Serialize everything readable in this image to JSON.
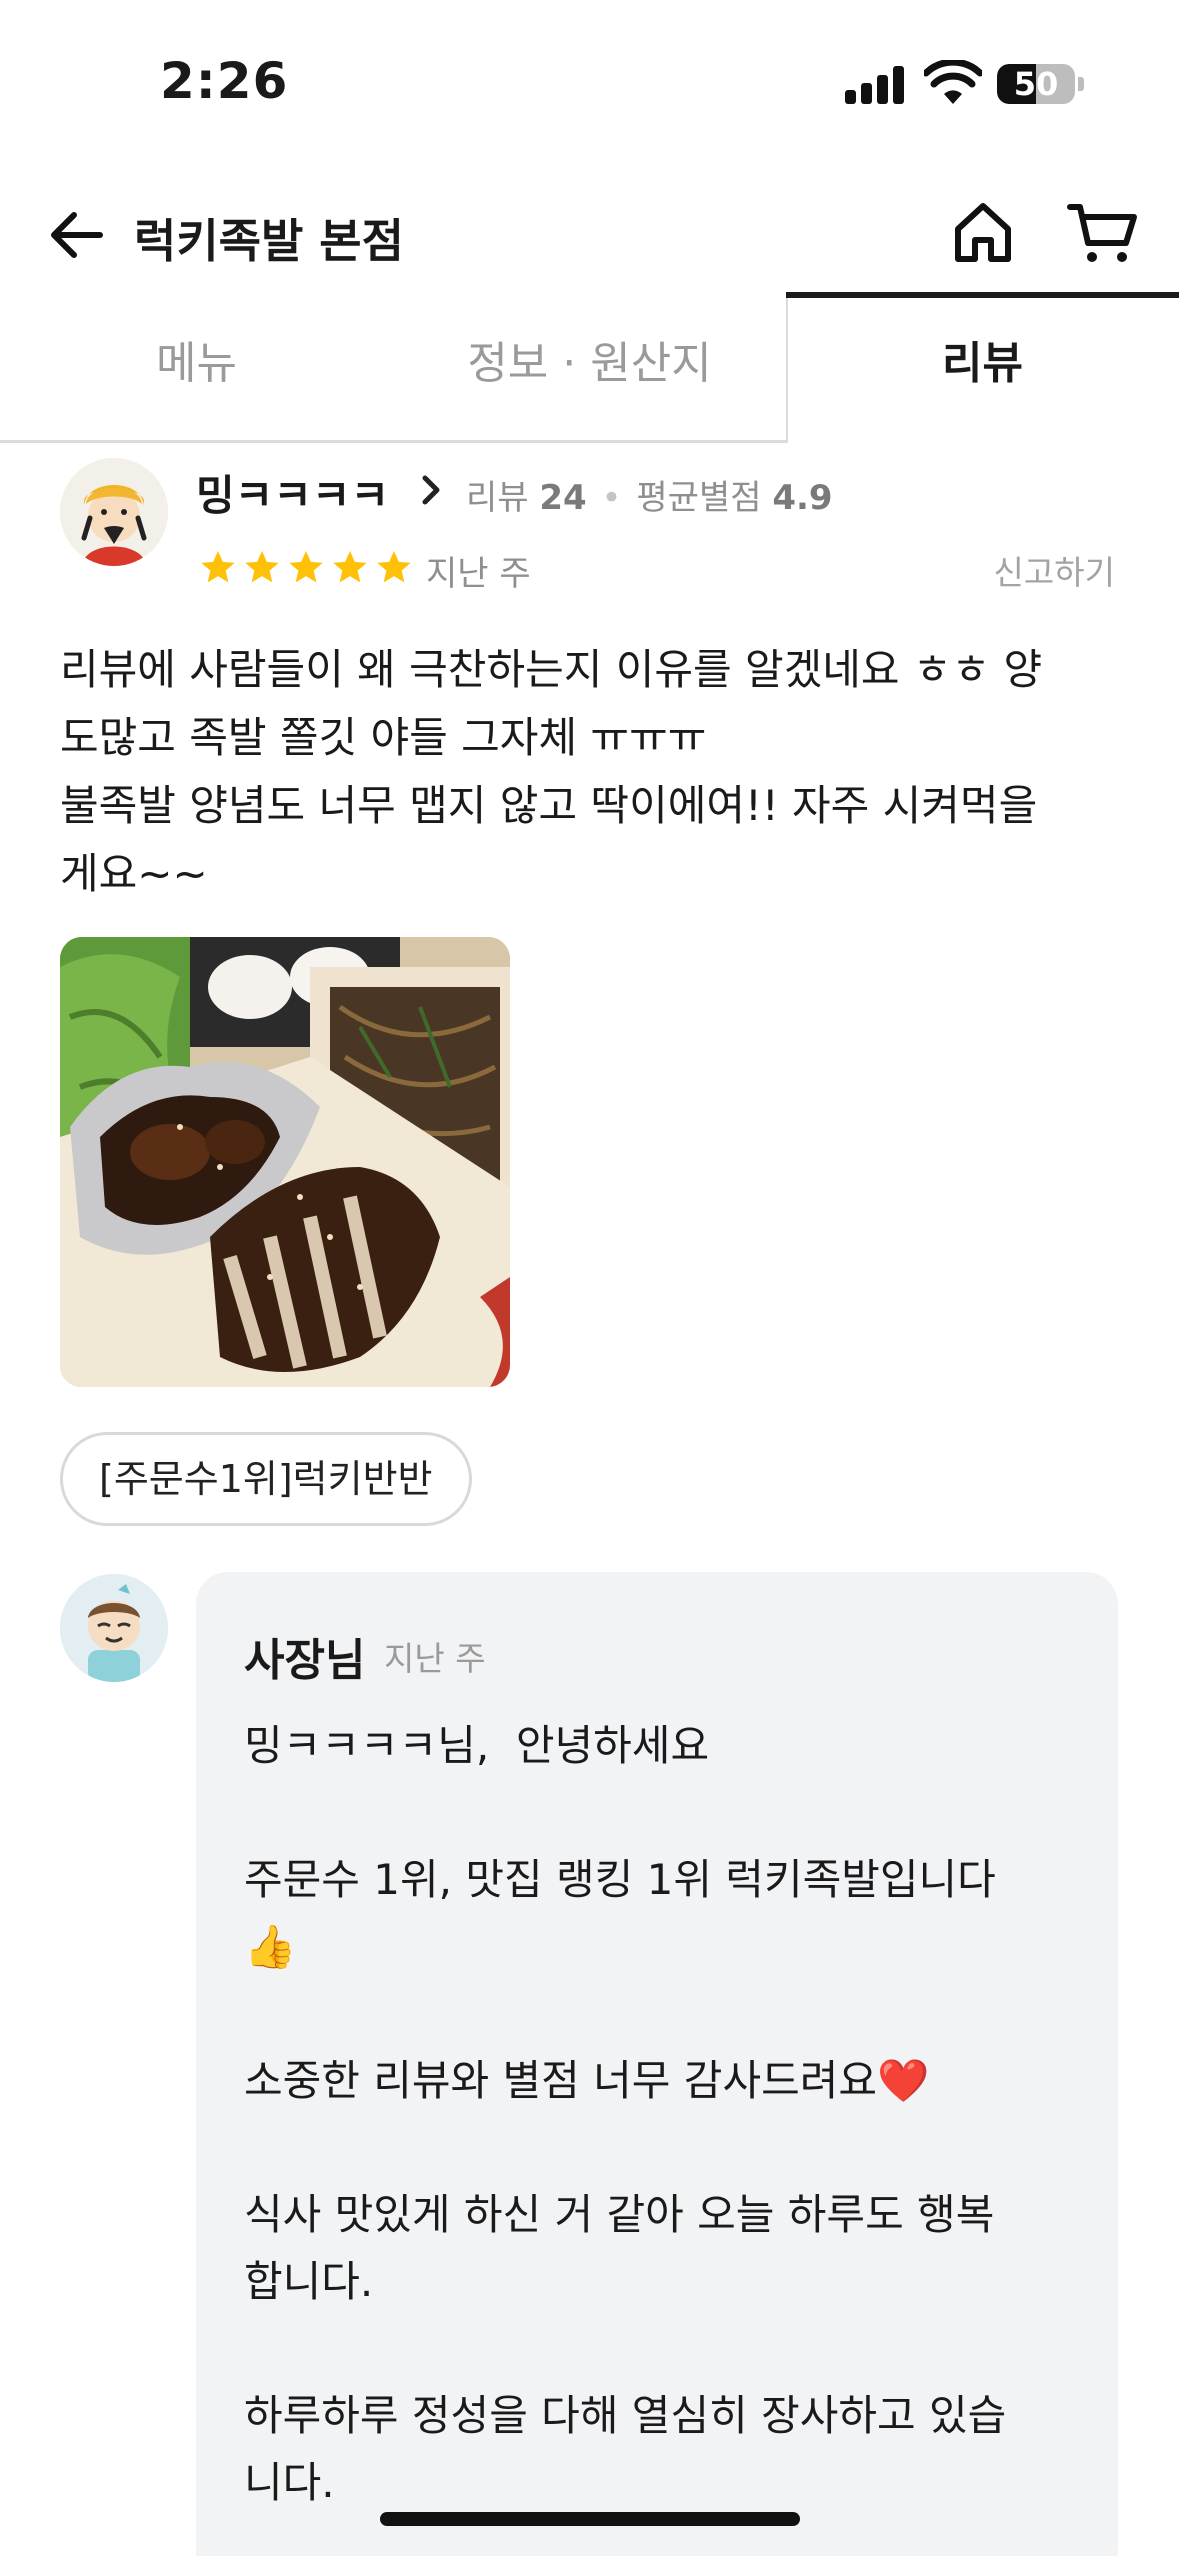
{
  "status_bar": {
    "time": "2:26",
    "battery": "50",
    "battery_level": 0.5
  },
  "header": {
    "title": "럭키족발 본점",
    "back_icon": "arrow-left-icon",
    "home_icon": "home-icon",
    "cart_icon": "cart-icon"
  },
  "tabs": [
    {
      "label": "메뉴",
      "active": false
    },
    {
      "label": "정보 · 원산지",
      "active": false
    },
    {
      "label": "리뷰",
      "active": true
    }
  ],
  "review": {
    "reviewer_name": "밍ㅋㅋㅋㅋ",
    "review_count_label": "리뷰",
    "review_count": "24",
    "avg_rating_label": "평균별점",
    "avg_rating": "4.9",
    "rating": 5,
    "star_color": "#FFC107",
    "date": "지난 주",
    "report_label": "신고하기",
    "text": "리뷰에 사람들이 왜 극찬하는지 이유를 알겠네요 ㅎㅎ 양\n도많고 족발 쫄깃 야들 그자체 ㅠㅠㅠ\n불족발 양념도 너무 맵지 않고 딱이에여!! 자주 시켜먹을\n게요~~",
    "ordered_menu": "[주문수1위]럭키반반"
  },
  "owner_reply": {
    "name": "사장님",
    "date": "지난 주",
    "text": "밍ㅋㅋㅋㅋ님,  안녕하세요\n\n주문수 1위, 맛집 랭킹 1위 럭키족발입니다\n👍\n\n소중한 리뷰와 별점 너무 감사드려요❤️\n\n식사 맛있게 하신 거 같아 오늘 하루도 행복\n합니다.\n\n하루하루 정성을 다해 열심히 장사하고 있습\n니다."
  }
}
